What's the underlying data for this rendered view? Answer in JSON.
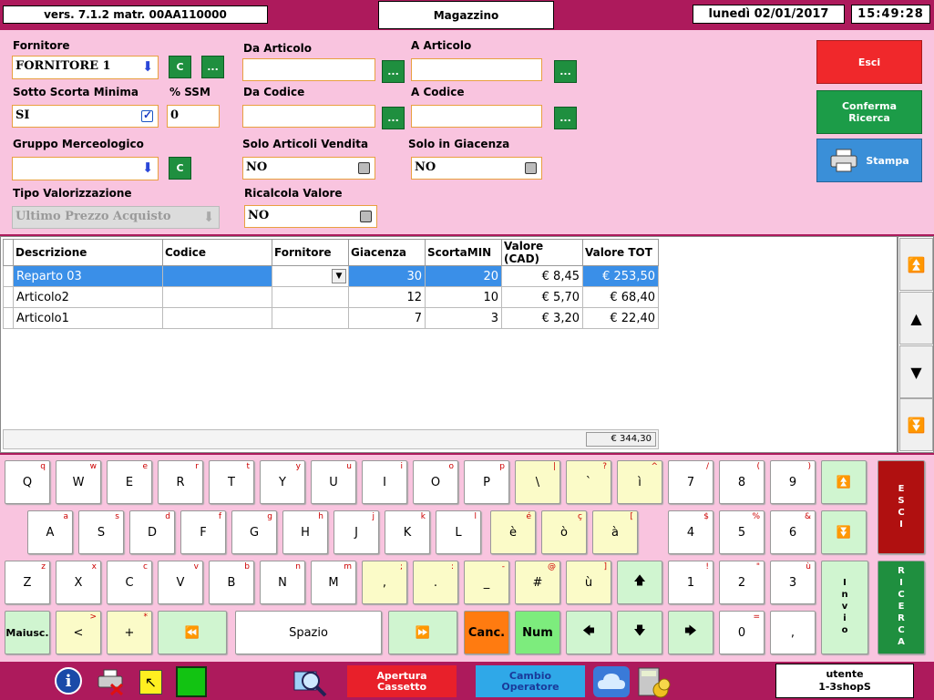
{
  "header": {
    "version": "vers. 7.1.2 matr. 00AA110000",
    "title": "Magazzino",
    "date": "lunedì 02/01/2017",
    "time": "15:49:28"
  },
  "form": {
    "fornitore": {
      "label": "Fornitore",
      "value": "FORNITORE 1",
      "btn_c": "C",
      "btn_more": "..."
    },
    "da_articolo": {
      "label": "Da Articolo",
      "value": "",
      "btn": "..."
    },
    "a_articolo": {
      "label": "A Articolo",
      "value": "",
      "btn": "..."
    },
    "sotto_scorta": {
      "label": "Sotto Scorta Minima",
      "value": "SI"
    },
    "ssm": {
      "label": "% SSM",
      "value": "0"
    },
    "da_codice": {
      "label": "Da Codice",
      "value": "",
      "btn": "..."
    },
    "a_codice": {
      "label": "A Codice",
      "value": "",
      "btn": "..."
    },
    "gruppo": {
      "label": "Gruppo Merceologico",
      "value": "",
      "btn_c": "C"
    },
    "solo_vendita": {
      "label": "Solo Articoli Vendita",
      "value": "NO"
    },
    "solo_giacenza": {
      "label": "Solo in Giacenza",
      "value": "NO"
    },
    "tipo_val": {
      "label": "Tipo Valorizzazione",
      "value": "Ultimo Prezzo Acquisto"
    },
    "ricalcola": {
      "label": "Ricalcola Valore",
      "value": "NO"
    }
  },
  "actions": {
    "esci": "Esci",
    "conferma_1": "Conferma",
    "conferma_2": "Ricerca",
    "stampa": "Stampa"
  },
  "table": {
    "columns": [
      "Descrizione",
      "Codice",
      "Fornitore",
      "Giacenza",
      "ScortaMIN",
      "Valore (CAD)",
      "Valore TOT"
    ],
    "rows": [
      {
        "descrizione": "Reparto 03",
        "codice": "",
        "fornitore": "",
        "giacenza": "30",
        "scorta": "20",
        "valore": "€ 8,45",
        "tot": "€ 253,50"
      },
      {
        "descrizione": "Articolo2",
        "codice": "",
        "fornitore": "",
        "giacenza": "12",
        "scorta": "10",
        "valore": "€ 5,70",
        "tot": "€ 68,40"
      },
      {
        "descrizione": "Articolo1",
        "codice": "",
        "fornitore": "",
        "giacenza": "7",
        "scorta": "3",
        "valore": "€ 3,20",
        "tot": "€ 22,40"
      }
    ],
    "total": "€ 344,30"
  },
  "keyboard": {
    "row1": [
      [
        "Q",
        "q"
      ],
      [
        "W",
        "w"
      ],
      [
        "E",
        "e"
      ],
      [
        "R",
        "r"
      ],
      [
        "T",
        "t"
      ],
      [
        "Y",
        "y"
      ],
      [
        "U",
        "u"
      ],
      [
        "I",
        "i"
      ],
      [
        "O",
        "o"
      ],
      [
        "P",
        "p"
      ],
      [
        "\\",
        "|"
      ],
      [
        "`",
        "?"
      ],
      [
        "ì",
        "^"
      ],
      [
        "7",
        "/"
      ],
      [
        "8",
        "("
      ],
      [
        "9",
        ")"
      ]
    ],
    "row2": [
      [
        "A",
        "a"
      ],
      [
        "S",
        "s"
      ],
      [
        "D",
        "d"
      ],
      [
        "F",
        "f"
      ],
      [
        "G",
        "g"
      ],
      [
        "H",
        "h"
      ],
      [
        "J",
        "j"
      ],
      [
        "K",
        "k"
      ],
      [
        "L",
        "l"
      ],
      [
        "è",
        "é"
      ],
      [
        "ò",
        "ç"
      ],
      [
        "à",
        "["
      ],
      [
        "4",
        "$"
      ],
      [
        "5",
        "%"
      ],
      [
        "6",
        "&"
      ]
    ],
    "row3": [
      [
        "Z",
        "z"
      ],
      [
        "X",
        "x"
      ],
      [
        "C",
        "c"
      ],
      [
        "V",
        "v"
      ],
      [
        "B",
        "b"
      ],
      [
        "N",
        "n"
      ],
      [
        "M",
        "m"
      ],
      [
        ",",
        ";"
      ],
      [
        ".",
        ":"
      ],
      [
        "_",
        "-"
      ],
      [
        "#",
        "@"
      ],
      [
        "ù",
        "]"
      ],
      [
        "1",
        "!"
      ],
      [
        "2",
        "\""
      ],
      [
        "3",
        "ù"
      ]
    ],
    "row4": {
      "maiusc": "Maiusc.",
      "lt": "<",
      "lt_s": ">",
      "plus": "+",
      "plus_s": "*",
      "spazio": "Spazio",
      "canc": "Canc.",
      "num": "Num",
      "zero": "0",
      "zero_s": "=",
      "comma": ","
    },
    "esci": "ESCI",
    "invio": "Invio",
    "ricerca": "RICERCA"
  },
  "bottom": {
    "apertura_1": "Apertura",
    "apertura_2": "Cassetto",
    "cambio_1": "Cambio",
    "cambio_2": "Operatore",
    "utente_1": "utente",
    "utente_2": "1-3shopS"
  }
}
